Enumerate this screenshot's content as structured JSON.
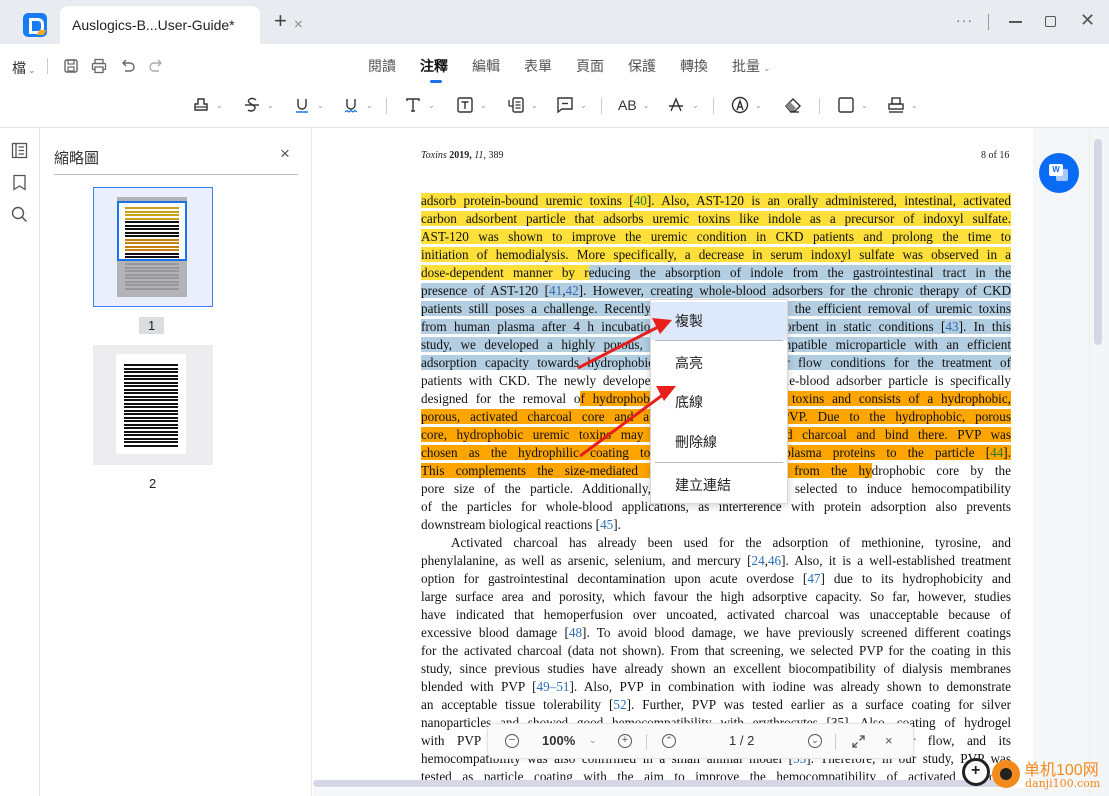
{
  "titlebar": {
    "tab_title": "Auslogics-B...User-Guide*",
    "tab_close": "×",
    "new_tab": "+",
    "more": "···",
    "close": "✕"
  },
  "menubar": {
    "file": "檔",
    "tabs": [
      {
        "label": "閱讀",
        "active": false
      },
      {
        "label": "注釋",
        "active": true
      },
      {
        "label": "編輯",
        "active": false
      },
      {
        "label": "表單",
        "active": false
      },
      {
        "label": "頁面",
        "active": false
      },
      {
        "label": "保護",
        "active": false
      },
      {
        "label": "轉換",
        "active": false
      },
      {
        "label": "批量",
        "active": false,
        "dropdown": true
      }
    ]
  },
  "annot_tools": [
    {
      "name": "highlight-tool",
      "glyph": "⌂"
    },
    {
      "name": "strikethrough-tool",
      "glyph": "S̶"
    },
    {
      "name": "underline-tool",
      "glyph": "U̲"
    },
    {
      "name": "squiggly-tool",
      "glyph": "Ṵ"
    },
    {
      "name": "text-tool",
      "glyph": "T"
    },
    {
      "name": "textbox-tool",
      "glyph": "⊤"
    },
    {
      "name": "callout-tool",
      "glyph": "▤"
    },
    {
      "name": "comment-tool",
      "glyph": "▭"
    },
    {
      "name": "replace-text-tool",
      "glyph": "AB"
    },
    {
      "name": "insert-text-tool",
      "glyph": "A"
    },
    {
      "name": "pencil-tool",
      "glyph": "Ⓐ"
    },
    {
      "name": "eraser-tool",
      "glyph": "◇"
    },
    {
      "name": "shape-tool",
      "glyph": "□"
    },
    {
      "name": "stamp-tool",
      "glyph": "⊥"
    }
  ],
  "thumbnails": {
    "title": "縮略圖",
    "close": "×",
    "pages": [
      {
        "label": "1",
        "active": true
      },
      {
        "label": "2",
        "active": false
      }
    ]
  },
  "document": {
    "header_journal": "Toxins",
    "header_year": "2019,",
    "header_volume": "11,",
    "header_page": "389",
    "page_of": "8 of 16",
    "lines": [
      {
        "segs": [
          {
            "t": "adsorb protein-bound uremic toxins [",
            "h": "y"
          },
          {
            "t": "40",
            "h": "y",
            "ref": "g"
          },
          {
            "t": "]. Also, AST-120 is an orally administered, intestinal, activated",
            "h": "y"
          }
        ]
      },
      {
        "segs": [
          {
            "t": "carbon adsorbent particle that adsorbs uremic toxins like indole as a precursor of indoxyl sulfate.",
            "h": "y"
          }
        ]
      },
      {
        "segs": [
          {
            "t": "AST-120 was shown to improve the uremic condition in CKD patients and prolong the time to",
            "h": "y"
          }
        ]
      },
      {
        "segs": [
          {
            "t": "initiation of hemodialysis. More specifically, a decrease in serum indoxyl sulfate was observed in a",
            "h": "y"
          }
        ]
      },
      {
        "segs": [
          {
            "t": "dose-dependent manner by r",
            "h": "y"
          },
          {
            "t": "educing the absorption of indole from the gastrointestinal tract in the",
            "h": "b"
          }
        ]
      },
      {
        "segs": [
          {
            "t": "presence of AST-120 [",
            "h": "b"
          },
          {
            "t": "41",
            "h": "b",
            "ref": "b"
          },
          {
            "t": ",",
            "h": "b"
          },
          {
            "t": "42",
            "h": "b",
            "ref": "b"
          },
          {
            "t": "]. However, creating whole-blood adsorbers for the chronic therapy of CKD",
            "h": "b"
          }
        ]
      },
      {
        "segs": [
          {
            "t": "patients still poses a challenge. Recently, ............................... and the efficient removal of uremic toxins",
            "h": "b"
          }
        ]
      },
      {
        "segs": [
          {
            "t": "from human plasma after 4 h incubation ............................. adsorbent in static conditions [",
            "h": "b"
          },
          {
            "t": "43",
            "h": "b",
            "ref": "b"
          },
          {
            "t": "]. In this",
            "h": "b"
          }
        ]
      },
      {
        "segs": [
          {
            "t": "study, we developed a highly porous, ................................. compatible microparticle with an efficient",
            "h": "b"
          }
        ]
      },
      {
        "segs": [
          {
            "t": "adsorption capacity towards hydrophobic ........................... under flow conditions for the treatment of",
            "h": "b"
          }
        ]
      },
      {
        "segs": [
          {
            "t": "patients with CKD. The newly developed ............................ whole-blood adsorber particle is specifically",
            "h": ""
          }
        ]
      },
      {
        "segs": [
          {
            "t": "designed for the removal o",
            "h": ""
          },
          {
            "t": "f hydrophobic ...................... uremic toxins and consists of a hydrophobic,",
            "h": "o"
          }
        ]
      },
      {
        "segs": [
          {
            "t": "porous, activated charcoal core and a h ....................... of PVP. Due to the hydrophobic, porous",
            "h": "o"
          }
        ]
      },
      {
        "segs": [
          {
            "t": "core, hydrophobic uremic toxins may ......................... activated charcoal and bind there.  PVP was",
            "h": "o"
          }
        ]
      },
      {
        "segs": [
          {
            "t": "chosen as the hydrophilic coating to c ...................... of plasma proteins to the particle [",
            "h": "o"
          },
          {
            "t": "44",
            "h": "o",
            "ref": "g"
          },
          {
            "t": "].",
            "h": "o"
          }
        ]
      },
      {
        "segs": [
          {
            "t": "This complements the size-mediated ex ................. proteins from the hy",
            "h": "o"
          },
          {
            "t": "drophobic core by the",
            "h": ""
          }
        ]
      },
      {
        "segs": [
          {
            "t": "pore size of the particle.  Additionally, the ..................... was selected to induce hemocompatibility",
            "h": ""
          }
        ]
      },
      {
        "segs": [
          {
            "t": "of the particles for whole-blood applications, as interference with protein adsorption also prevents",
            "h": ""
          }
        ]
      },
      {
        "last": true,
        "segs": [
          {
            "t": "downstream biological reactions [",
            "h": ""
          },
          {
            "t": "45",
            "h": "",
            "ref": "b"
          },
          {
            "t": "].",
            "h": ""
          }
        ]
      },
      {
        "indent": true,
        "segs": [
          {
            "t": "Activated charcoal has already been used for the adsorption of methionine, tyrosine, and",
            "h": ""
          }
        ]
      },
      {
        "segs": [
          {
            "t": "phenylalanine, as well as arsenic, selenium, and mercury [",
            "h": ""
          },
          {
            "t": "24",
            "h": "",
            "ref": "b"
          },
          {
            "t": ",",
            "h": ""
          },
          {
            "t": "46",
            "h": "",
            "ref": "b"
          },
          {
            "t": "]. Also, it is a well-established treatment",
            "h": ""
          }
        ]
      },
      {
        "segs": [
          {
            "t": "option for gastrointestinal decontamination upon acute overdose [",
            "h": ""
          },
          {
            "t": "47",
            "h": "",
            "ref": "b"
          },
          {
            "t": "] due to its hydrophobicity and",
            "h": ""
          }
        ]
      },
      {
        "segs": [
          {
            "t": "large surface area and porosity, which favour the high adsorptive capacity. So far, however, studies",
            "h": ""
          }
        ]
      },
      {
        "segs": [
          {
            "t": "have indicated that hemoperfusion over uncoated, activated charcoal was unacceptable because of",
            "h": ""
          }
        ]
      },
      {
        "segs": [
          {
            "t": "excessive blood damage [",
            "h": ""
          },
          {
            "t": "48",
            "h": "",
            "ref": "b"
          },
          {
            "t": "]. To avoid blood damage, we have previously screened different coatings",
            "h": ""
          }
        ]
      },
      {
        "segs": [
          {
            "t": "for the activated charcoal (data not shown). From that screening, we selected PVP for the coating in this",
            "h": ""
          }
        ]
      },
      {
        "segs": [
          {
            "t": "study, since previous studies have already shown an excellent biocompatibility of dialysis membranes",
            "h": ""
          }
        ]
      },
      {
        "segs": [
          {
            "t": "blended with PVP [",
            "h": ""
          },
          {
            "t": "49–51",
            "h": "",
            "ref": "b"
          },
          {
            "t": "]. Also, PVP in combination with iodine was already shown to demonstrate",
            "h": ""
          }
        ]
      },
      {
        "segs": [
          {
            "t": "an acceptable tissue tolerability [",
            "h": ""
          },
          {
            "t": "52",
            "h": "",
            "ref": "b"
          },
          {
            "t": "].  Further, PVP was tested earlier as a surface coating for silver",
            "h": ""
          }
        ]
      },
      {
        "segs": [
          {
            "t": "nanoparticles and showed good hemocompatibility with erythrocytes [35]. Also, coating of hydrogel",
            "h": ""
          }
        ]
      },
      {
        "segs": [
          {
            "t": "with PVP resulted in reduced protein adsorption and platelet adhesion under flow, and its",
            "h": ""
          }
        ]
      },
      {
        "segs": [
          {
            "t": "hemocompatibility was also confirmed in a small animal model [",
            "h": ""
          },
          {
            "t": "53",
            "h": "",
            "ref": "b"
          },
          {
            "t": "]. Therefore, in our study, PVP was",
            "h": ""
          }
        ]
      },
      {
        "segs": [
          {
            "t": "tested as particle coating with the aim to improve the hemocompatibility of activated charcoal",
            "h": ""
          }
        ]
      }
    ]
  },
  "context_menu": {
    "items": [
      {
        "label": "複製",
        "hover": true
      },
      {
        "label": "高亮",
        "hover": false
      },
      {
        "label": "底線",
        "hover": false
      },
      {
        "label": "刪除線",
        "hover": false
      },
      {
        "label": "建立連結",
        "hover": false
      }
    ]
  },
  "float_bar": {
    "zoom": "100%",
    "page_indicator": "1 / 2",
    "close": "×"
  },
  "watermark": {
    "text_cn": "单机100网",
    "text_url": "danji100.com"
  },
  "colors": {
    "accent": "#1a73e8",
    "highlight_yellow": "#ffe03a",
    "highlight_blue": "#b3cde1",
    "highlight_orange": "#ffa500",
    "arrow_red": "#e8201c"
  }
}
